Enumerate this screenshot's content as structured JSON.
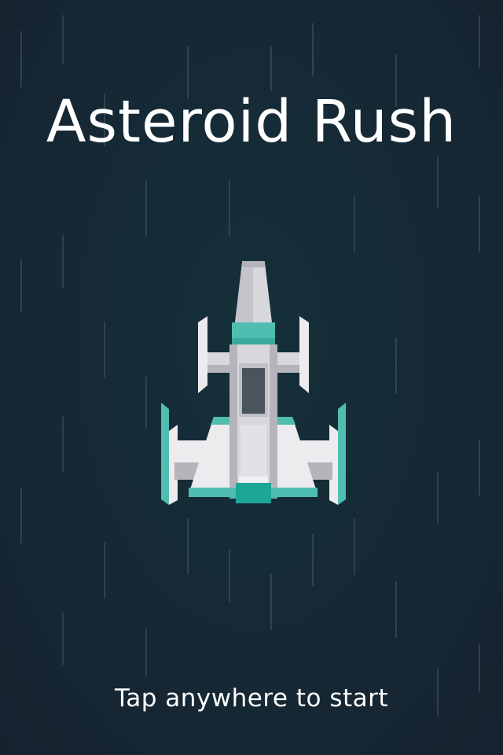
{
  "game": {
    "title": "Asteroid Rush",
    "start_prompt": "Tap anywhere to start"
  },
  "ship": {
    "icon": "spaceship-icon",
    "colors": {
      "hull": "#d8d8dc",
      "hull_light": "#ececee",
      "hull_shadow": "#b4b4ba",
      "accent": "#4fbdb0",
      "accent_dark": "#1ea697",
      "cockpit": "#4a545c"
    }
  },
  "background": {
    "colors": [
      "#17222f",
      "#15303a"
    ],
    "effect": "falling-rain-streaks"
  }
}
